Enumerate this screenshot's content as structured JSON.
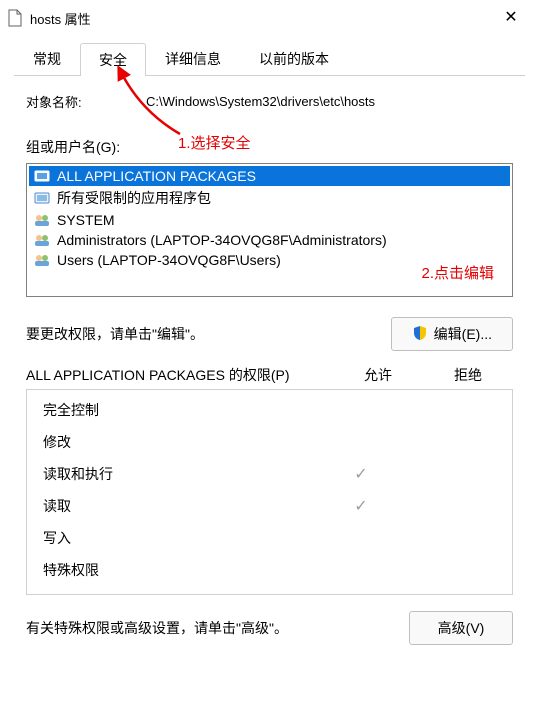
{
  "window": {
    "title": "hosts 属性",
    "close_glyph": "✕"
  },
  "tabs": [
    {
      "label": "常规",
      "active": false
    },
    {
      "label": "安全",
      "active": true
    },
    {
      "label": "详细信息",
      "active": false
    },
    {
      "label": "以前的版本",
      "active": false
    }
  ],
  "object_name": {
    "label": "对象名称:",
    "value": "C:\\Windows\\System32\\drivers\\etc\\hosts"
  },
  "annotations": {
    "select_security": "1.选择安全",
    "click_edit": "2.点击编辑"
  },
  "groups": {
    "label": "组或用户名(G):",
    "items": [
      {
        "name": "ALL APPLICATION PACKAGES",
        "icon": "package-icon",
        "selected": true
      },
      {
        "name": "所有受限制的应用程序包",
        "icon": "package-icon",
        "selected": false
      },
      {
        "name": "SYSTEM",
        "icon": "users-icon",
        "selected": false
      },
      {
        "name": "Administrators (LAPTOP-34OVQG8F\\Administrators)",
        "icon": "users-icon",
        "selected": false
      },
      {
        "name": "Users (LAPTOP-34OVQG8F\\Users)",
        "icon": "users-icon",
        "selected": false
      }
    ]
  },
  "edit_section": {
    "prompt": "要更改权限，请单击\"编辑\"。",
    "button_label": "编辑(E)..."
  },
  "permissions": {
    "header_for": "ALL APPLICATION PACKAGES 的权限(P)",
    "col_allow": "允许",
    "col_deny": "拒绝",
    "rows": [
      {
        "label": "完全控制",
        "allow": false,
        "deny": false
      },
      {
        "label": "修改",
        "allow": false,
        "deny": false
      },
      {
        "label": "读取和执行",
        "allow": true,
        "deny": false
      },
      {
        "label": "读取",
        "allow": true,
        "deny": false
      },
      {
        "label": "写入",
        "allow": false,
        "deny": false
      },
      {
        "label": "特殊权限",
        "allow": false,
        "deny": false
      }
    ]
  },
  "advanced_section": {
    "prompt": "有关特殊权限或高级设置，请单击\"高级\"。",
    "button_label": "高级(V)"
  }
}
